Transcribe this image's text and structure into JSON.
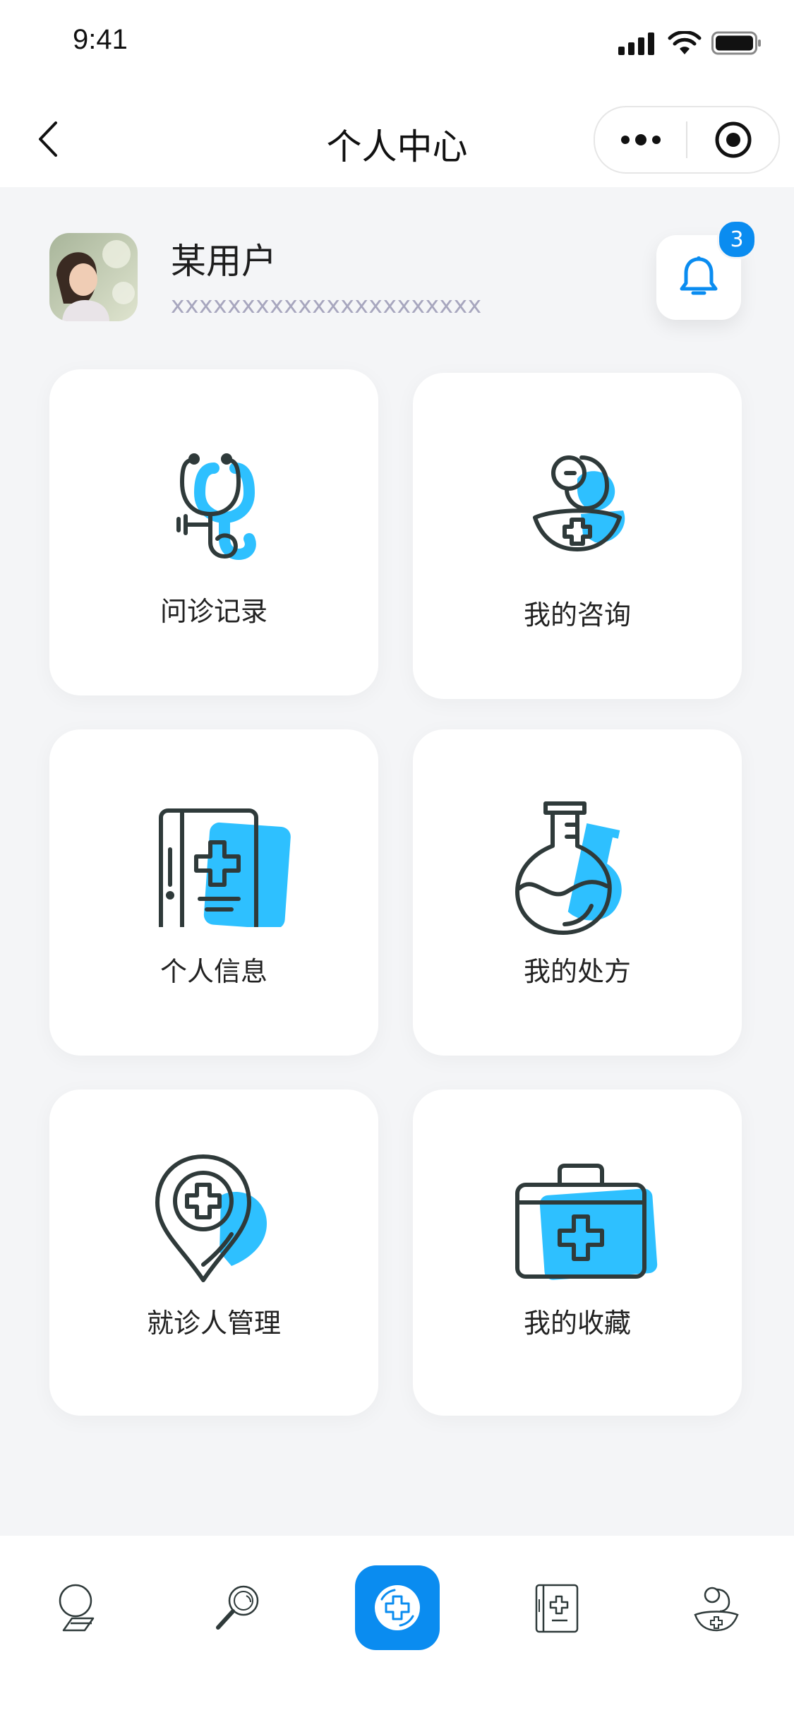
{
  "status": {
    "time": "9:41"
  },
  "nav": {
    "title": "个人中心"
  },
  "profile": {
    "name": "某用户",
    "subtitle": "xxxxxxxxxxxxxxxxxxxxxx",
    "notification_count": "3"
  },
  "menu": [
    {
      "label": "问诊记录",
      "icon": "stethoscope-icon"
    },
    {
      "label": "我的咨询",
      "icon": "doctor-icon"
    },
    {
      "label": "个人信息",
      "icon": "medical-book-icon"
    },
    {
      "label": "我的处方",
      "icon": "flask-icon"
    },
    {
      "label": "就诊人管理",
      "icon": "location-pin-cross-icon"
    },
    {
      "label": "我的收藏",
      "icon": "first-aid-kit-icon"
    }
  ],
  "tabbar": {
    "items": [
      {
        "icon": "consult-icon"
      },
      {
        "icon": "search-icon"
      },
      {
        "icon": "home-cross-icon",
        "active": true
      },
      {
        "icon": "medical-book-icon"
      },
      {
        "icon": "doctor-icon"
      }
    ]
  },
  "colors": {
    "accent": "#0a8cf0",
    "accent_light": "#2ec0ff",
    "outline": "#2f3a3a",
    "background": "#f4f5f7"
  }
}
